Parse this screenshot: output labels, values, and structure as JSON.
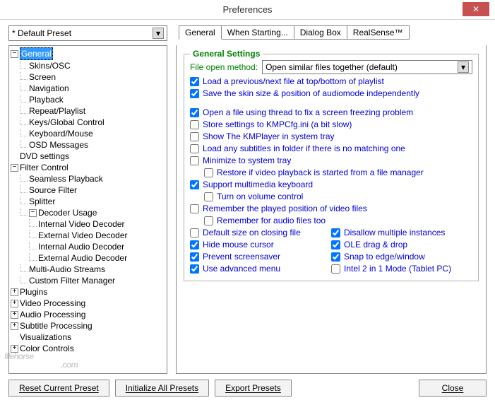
{
  "window": {
    "title": "Preferences"
  },
  "preset": {
    "value": "* Default Preset"
  },
  "tabs": {
    "general": "General",
    "when_starting": "When Starting...",
    "dialog_box": "Dialog Box",
    "realsense": "RealSense™"
  },
  "tree": {
    "general": "General",
    "general_children": [
      "Skins/OSC",
      "Screen",
      "Navigation",
      "Playback",
      "Repeat/Playlist",
      "Keys/Global Control",
      "Keyboard/Mouse",
      "OSD Messages"
    ],
    "dvd": "DVD settings",
    "filter": "Filter Control",
    "filter_children": [
      "Seamless Playback",
      "Source Filter",
      "Splitter"
    ],
    "decoder": "Decoder Usage",
    "decoder_children": [
      "Internal Video Decoder",
      "External Video Decoder",
      "Internal Audio Decoder",
      "External Audio Decoder"
    ],
    "filter_tail": [
      "Multi-Audio Streams",
      "Custom Filter Manager"
    ],
    "plugins": "Plugins",
    "video_proc": "Video Processing",
    "audio_proc": "Audio Processing",
    "subtitle_proc": "Subtitle Processing",
    "visualizations": "Visualizations",
    "color_controls": "Color Controls"
  },
  "settings": {
    "group_title": "General Settings",
    "file_open_label": "File open method:",
    "file_open_value": "Open similar files together (default)",
    "cb_load_prev": "Load a previous/next file at top/bottom of playlist",
    "cb_save_skin": "Save the skin size & position of audiomode independently",
    "cb_thread": "Open a file using thread to fix a screen freezing problem",
    "cb_store_ini": "Store settings to KMPCfg.ini (a bit slow)",
    "cb_tray": "Show The KMPlayer in system tray",
    "cb_subs": "Load any subtitles in folder if there is no matching one",
    "cb_min_tray": "Minimize to system tray",
    "cb_restore": "Restore if video playback is started from a file manager",
    "cb_mm_kb": "Support multimedia keyboard",
    "cb_vol": "Turn on volume control",
    "cb_remember_pos": "Remember the played position of video files",
    "cb_remember_audio": "Remember for audio files too",
    "cb_default_size": "Default size on closing file",
    "cb_disallow": "Disallow multiple instances",
    "cb_hide_cursor": "Hide mouse cursor",
    "cb_ole": "OLE drag & drop",
    "cb_screensaver": "Prevent screensaver",
    "cb_snap": "Snap to edge/window",
    "cb_adv_menu": "Use advanced menu",
    "cb_tablet": "Intel 2 in 1 Mode (Tablet PC)"
  },
  "buttons": {
    "reset": "Reset Current Preset",
    "init": "Initialize All Presets",
    "export": "Export Presets",
    "close": "Close"
  },
  "watermark": {
    "main": "filehorse",
    "sub": ".com"
  }
}
